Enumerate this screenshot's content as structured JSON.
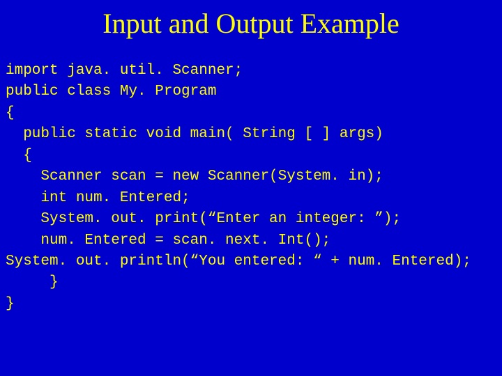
{
  "slide": {
    "title": "Input and Output Example",
    "code": {
      "line1": "import java. util. Scanner;",
      "line2": "public class My. Program",
      "line3": "{",
      "line4": "  public static void main( String [ ] args)",
      "line5": "  {",
      "line6": "    Scanner scan = new Scanner(System. in);",
      "line7": "    int num. Entered;",
      "line8": "    System. out. print(“Enter an integer: ”);",
      "line9": "    num. Entered = scan. next. Int();",
      "line10": "System. out. println(“You entered: “ + num. Entered);",
      "line11": "     }",
      "line12": "}"
    }
  }
}
